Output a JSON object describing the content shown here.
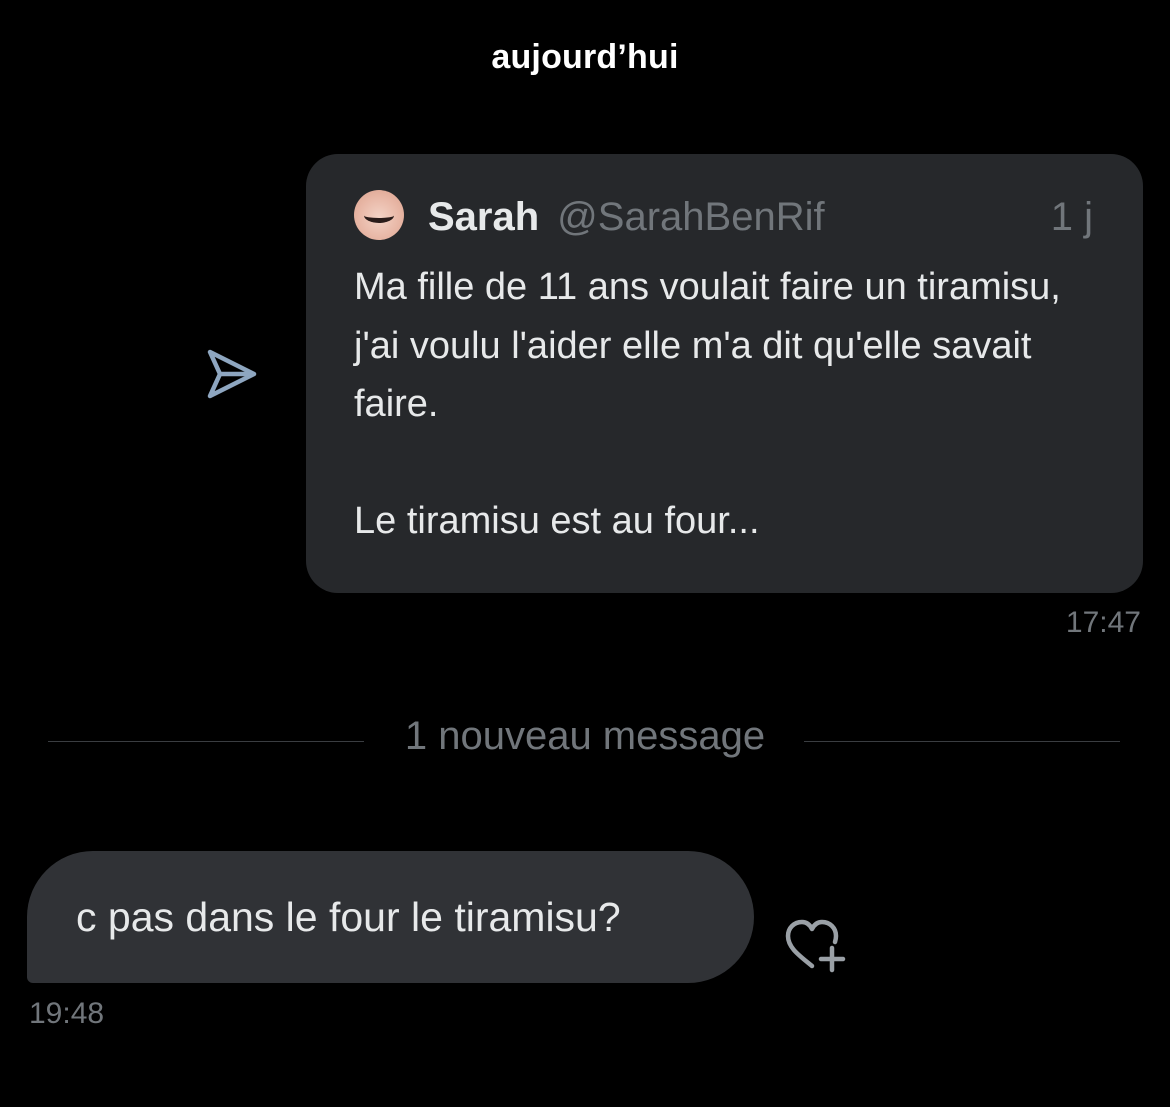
{
  "conversation": {
    "date_label": "aujourd’hui",
    "divider_label": "1 nouveau message"
  },
  "outgoing": {
    "share_icon": "send-arrow-icon",
    "quoted_post": {
      "author_name": "Sarah",
      "author_handle": "@SarahBenRif",
      "age": "1 j",
      "text": "Ma fille de 11 ans voulait faire un tiramisu, j'ai voulu l'aider elle m'a dit qu'elle savait faire.\n\nLe tiramisu est au four..."
    },
    "time": "17:47"
  },
  "incoming": {
    "text": "c pas dans le four le tiramisu?",
    "time": "19:48",
    "react_icon": "heart-plus-icon"
  },
  "colors": {
    "background": "#000000",
    "card": "#26282b",
    "incoming_bubble": "#303236",
    "secondary_text": "#71767b",
    "primary_text": "#e7e9ea",
    "icon_accent": "#8ea6c0"
  }
}
